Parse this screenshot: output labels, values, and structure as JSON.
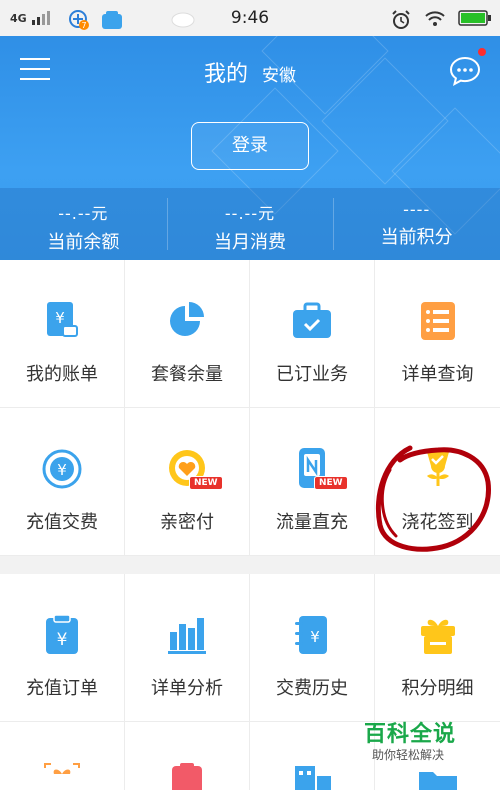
{
  "status_bar": {
    "network": "4G",
    "time": "9:46",
    "notification_badge": "7"
  },
  "header": {
    "title": "我的",
    "region": "安徽",
    "login_label": "登录"
  },
  "stats": [
    {
      "value": "--.--元",
      "label": "当前余额"
    },
    {
      "value": "--.--元",
      "label": "当月消费"
    },
    {
      "value": "----",
      "label": "当前积分"
    }
  ],
  "grid1": [
    {
      "label": "我的账单",
      "icon": "bill-icon"
    },
    {
      "label": "套餐余量",
      "icon": "pie-chart-icon"
    },
    {
      "label": "已订业务",
      "icon": "briefcase-check-icon"
    },
    {
      "label": "详单查询",
      "icon": "list-detail-icon"
    },
    {
      "label": "充值交费",
      "icon": "yuan-cycle-icon"
    },
    {
      "label": "亲密付",
      "icon": "heart-pay-icon",
      "badge": "NEW"
    },
    {
      "label": "流量直充",
      "icon": "phone-data-icon",
      "badge": "NEW"
    },
    {
      "label": "浇花签到",
      "icon": "flower-checkin-icon"
    }
  ],
  "grid2": [
    {
      "label": "充值订单",
      "icon": "clipboard-yuan-icon"
    },
    {
      "label": "详单分析",
      "icon": "bar-chart-icon"
    },
    {
      "label": "交费历史",
      "icon": "notebook-yuan-icon"
    },
    {
      "label": "积分明细",
      "icon": "gift-icon"
    },
    {
      "label": "",
      "icon": "gift-box-icon"
    },
    {
      "label": "",
      "icon": "clipboard-check-icon"
    },
    {
      "label": "",
      "icon": "building-icon"
    },
    {
      "label": "",
      "icon": "folder-icon"
    }
  ],
  "watermark": {
    "title": "百科全说",
    "subtitle": "助你轻松解决"
  },
  "colors": {
    "header_blue": "#3a9bec",
    "icon_blue": "#3ba3ec",
    "icon_orange": "#ff9f43",
    "icon_yellow": "#ffc61a",
    "badge_red": "#e8322b",
    "annotation_red": "#b0000a",
    "watermark_green": "#1aa84a"
  }
}
